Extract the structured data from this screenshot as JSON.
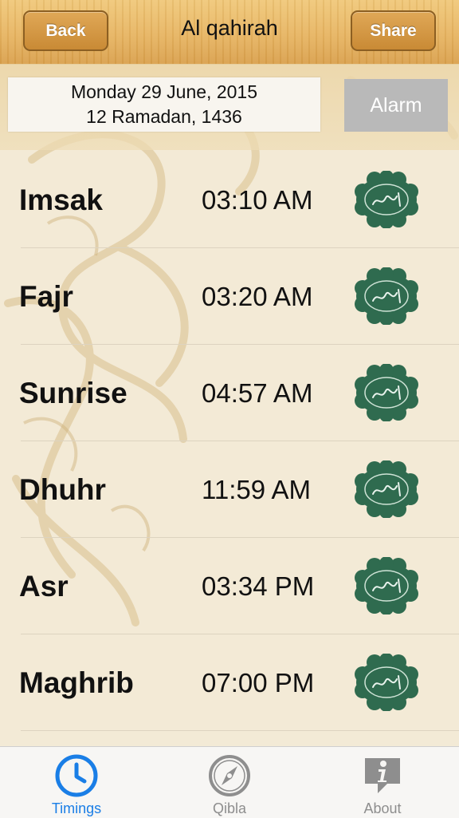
{
  "header": {
    "title": "Al qahirah",
    "back_label": "Back",
    "share_label": "Share"
  },
  "date": {
    "gregorian": "Monday 29 June, 2015",
    "hijri": "12 Ramadan, 1436"
  },
  "alarm_label": "Alarm",
  "prayers": [
    {
      "name": "Imsak",
      "time": "03:10 AM"
    },
    {
      "name": "Fajr",
      "time": "03:20 AM"
    },
    {
      "name": "Sunrise",
      "time": "04:57 AM"
    },
    {
      "name": "Dhuhr",
      "time": "11:59 AM"
    },
    {
      "name": "Asr",
      "time": "03:34 PM"
    },
    {
      "name": "Maghrib",
      "time": "07:00 PM"
    }
  ],
  "tabs": [
    {
      "label": "Timings",
      "icon": "clock-icon",
      "active": true
    },
    {
      "label": "Qibla",
      "icon": "compass-icon",
      "active": false
    },
    {
      "label": "About",
      "icon": "info-bubble-icon",
      "active": false
    }
  ],
  "colors": {
    "active_tab": "#1a7ee6",
    "emblem_green": "#2f6b4f",
    "navbar_wood": "#e7b461"
  }
}
